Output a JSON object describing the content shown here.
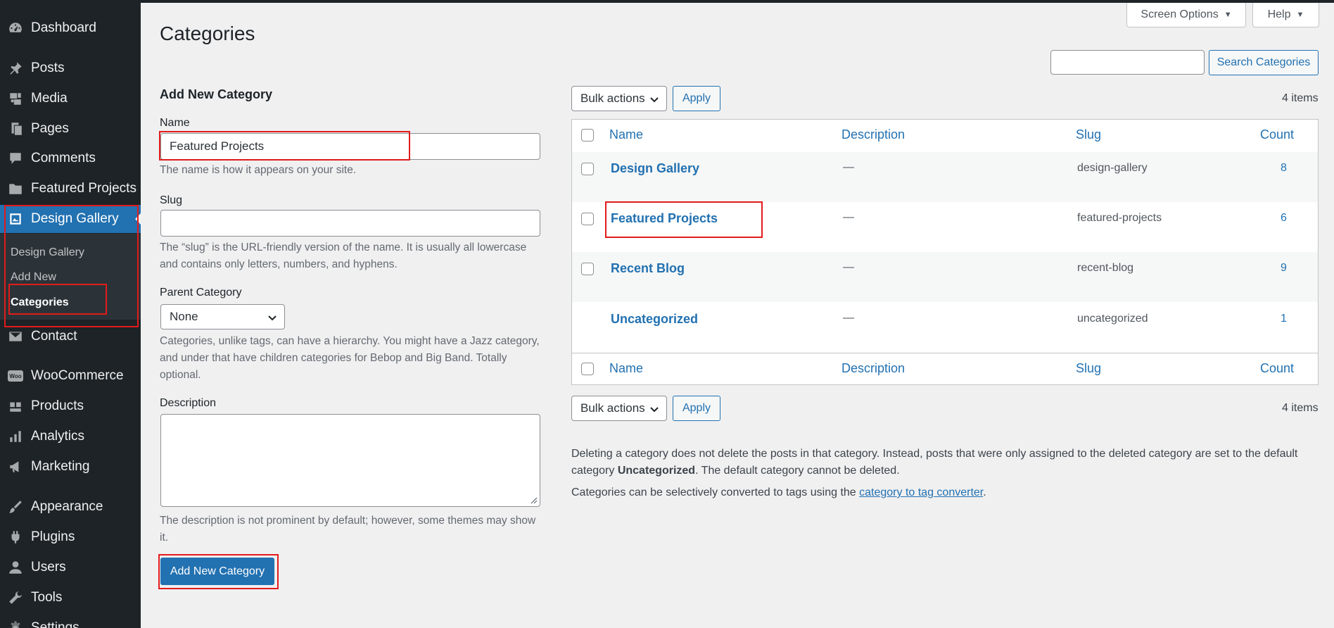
{
  "sidebar": {
    "items": [
      {
        "id": "dashboard",
        "label": "Dashboard",
        "icon": "dashboard-icon"
      },
      {
        "id": "posts",
        "label": "Posts",
        "icon": "pin-icon"
      },
      {
        "id": "media",
        "label": "Media",
        "icon": "media-icon"
      },
      {
        "id": "pages",
        "label": "Pages",
        "icon": "pages-icon"
      },
      {
        "id": "comments",
        "label": "Comments",
        "icon": "comment-icon"
      },
      {
        "id": "featured-projects",
        "label": "Featured Projects",
        "icon": "folder-icon"
      },
      {
        "id": "design-gallery",
        "label": "Design Gallery",
        "icon": "gallery-icon"
      },
      {
        "id": "contact",
        "label": "Contact",
        "icon": "mail-icon"
      },
      {
        "id": "woocommerce",
        "label": "WooCommerce",
        "icon": "woo-icon",
        "badge": "Woo"
      },
      {
        "id": "products",
        "label": "Products",
        "icon": "products-icon"
      },
      {
        "id": "analytics",
        "label": "Analytics",
        "icon": "analytics-icon"
      },
      {
        "id": "marketing",
        "label": "Marketing",
        "icon": "megaphone-icon"
      },
      {
        "id": "appearance",
        "label": "Appearance",
        "icon": "brush-icon"
      },
      {
        "id": "plugins",
        "label": "Plugins",
        "icon": "plugin-icon"
      },
      {
        "id": "users",
        "label": "Users",
        "icon": "user-icon"
      },
      {
        "id": "tools",
        "label": "Tools",
        "icon": "wrench-icon"
      },
      {
        "id": "settings",
        "label": "Settings",
        "icon": "settings-icon"
      }
    ],
    "submenu": [
      "Design Gallery",
      "Add New",
      "Categories"
    ]
  },
  "header": {
    "title": "Categories",
    "screen_options": "Screen Options",
    "help": "Help",
    "search_button": "Search Categories"
  },
  "form": {
    "heading": "Add New Category",
    "name_label": "Name",
    "name_value": "Featured Projects",
    "name_help": "The name is how it appears on your site.",
    "slug_label": "Slug",
    "slug_value": "",
    "slug_help": "The “slug” is the URL-friendly version of the name. It is usually all lowercase and contains only letters, numbers, and hyphens.",
    "parent_label": "Parent Category",
    "parent_value": "None",
    "parent_help": "Categories, unlike tags, can have a hierarchy. You might have a Jazz category, and under that have children categories for Bebop and Big Band. Totally optional.",
    "description_label": "Description",
    "description_help": "The description is not prominent by default; however, some themes may show it.",
    "submit": "Add New Category"
  },
  "table": {
    "bulk_actions": "Bulk actions",
    "apply": "Apply",
    "items_count": "4 items",
    "columns": {
      "name": "Name",
      "description": "Description",
      "slug": "Slug",
      "count": "Count"
    },
    "rows": [
      {
        "name": "Design Gallery",
        "description": "—",
        "slug": "design-gallery",
        "count": "8"
      },
      {
        "name": "Featured Projects",
        "description": "—",
        "slug": "featured-projects",
        "count": "6"
      },
      {
        "name": "Recent Blog",
        "description": "—",
        "slug": "recent-blog",
        "count": "9"
      },
      {
        "name": "Uncategorized",
        "description": "—",
        "slug": "uncategorized",
        "count": "1"
      }
    ]
  },
  "notes": {
    "delete_note_1": "Deleting a category does not delete the posts in that category. Instead, posts that were only assigned to the deleted category are set to the default category ",
    "delete_note_bold": "Uncategorized",
    "delete_note_2": ". The default category cannot be deleted.",
    "convert_note_1": "Categories can be selectively converted to tags using the ",
    "convert_link": "category to tag converter",
    "convert_note_2": "."
  },
  "colors": {
    "sidebar_bg": "#1d2327",
    "accent": "#2271b1",
    "highlight_box": "#e11b1b"
  }
}
